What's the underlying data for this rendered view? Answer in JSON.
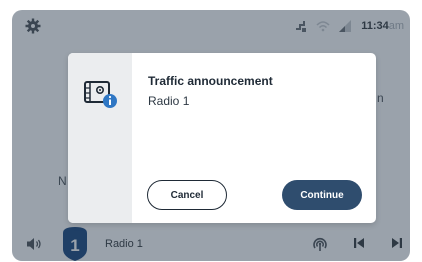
{
  "status_bar": {
    "time": "11:34",
    "ampm": "am",
    "icons": [
      "settings-gear-icon",
      "phone-signal-icon",
      "wifi-icon",
      "cellular-signal-icon"
    ]
  },
  "background": {
    "fragment_right": "n",
    "fragment_left": "N"
  },
  "bottom_bar": {
    "station_label": "Radio 1",
    "icons": [
      "volume-icon",
      "preset-tag-icon",
      "hd-radio-icon",
      "previous-track-icon",
      "next-track-icon"
    ]
  },
  "dialog": {
    "icon": "traffic-info-icon",
    "title": "Traffic announcement",
    "subtitle": "Radio 1",
    "cancel_label": "Cancel",
    "continue_label": "Continue"
  },
  "colors": {
    "overlay_background": "#9aa2ab",
    "dialog_background": "#ffffff",
    "dialog_sidebar": "#ebedef",
    "primary_button": "#2f4d6e",
    "info_badge": "#2f77c4",
    "preset_badge": "#1f3f66"
  }
}
